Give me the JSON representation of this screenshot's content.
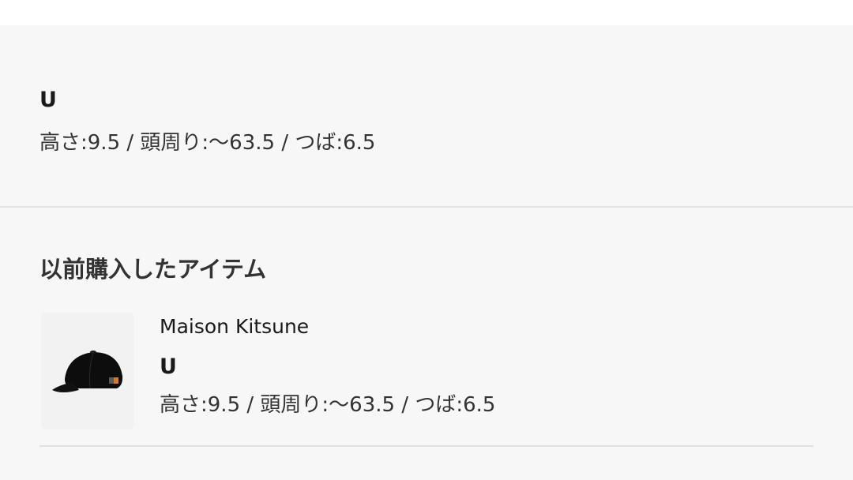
{
  "size_info": {
    "size": "U",
    "details": "高さ:9.5 / 頭周り:〜63.5 / つば:6.5"
  },
  "previous_purchases": {
    "title": "以前購入したアイテム",
    "items": [
      {
        "brand": "Maison Kitsune",
        "size": "U",
        "details": "高さ:9.5 / 頭周り:〜63.5 / つば:6.5",
        "image_icon": "black-cap-with-fox-patch"
      }
    ]
  },
  "colors": {
    "panel_background": "#f7f7f7",
    "divider": "#e2e2e2",
    "text_primary": "#1a1a1a"
  }
}
